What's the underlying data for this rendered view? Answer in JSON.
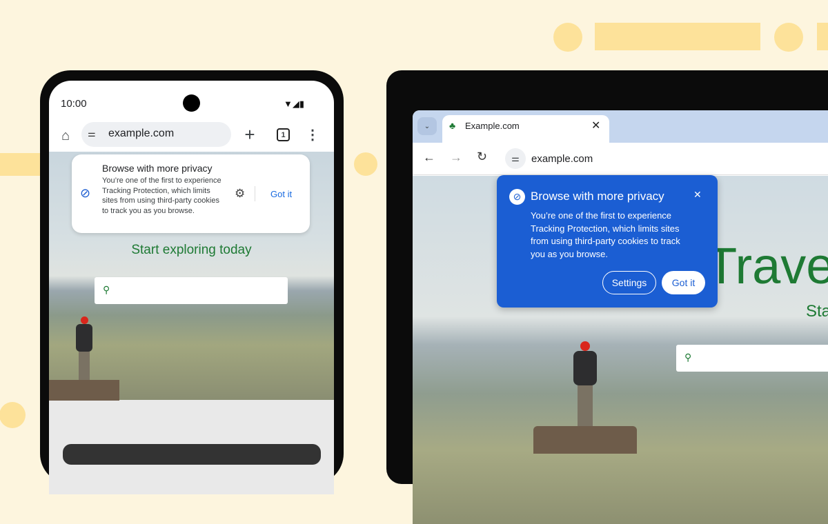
{
  "colors": {
    "background": "#fdf5de",
    "accent_yellow": "#fde29a",
    "popup_blue": "#1b5ed3",
    "brand_green": "#1e7a34",
    "link_blue": "#1a6be0"
  },
  "phone": {
    "status": {
      "time": "10:00"
    },
    "toolbar": {
      "url": "example.com",
      "tab_count": "1"
    },
    "popup": {
      "title": "Browse with more privacy",
      "body": "You’re one of the first to experience Tracking Protection, which limits sites from using third-party cookies to track you as you browse.",
      "got_it": "Got it"
    },
    "page": {
      "heading": "Start exploring today"
    }
  },
  "laptop": {
    "tab": {
      "title": "Example.com"
    },
    "toolbar": {
      "url": "example.com"
    },
    "popup": {
      "title": "Browse with more privacy",
      "body": "You’re one of the first to experience Tracking Protection, which limits sites from using third-party cookies to track you as you browse.",
      "settings": "Settings",
      "got_it": "Got it"
    },
    "page": {
      "heading": "Trave",
      "subheading": "Sta"
    }
  }
}
